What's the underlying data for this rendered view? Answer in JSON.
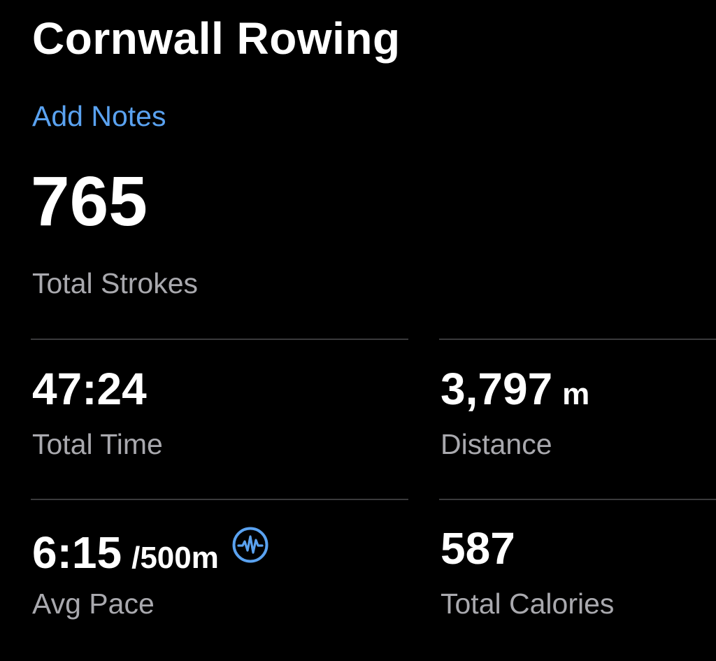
{
  "workout": {
    "title": "Cornwall Rowing",
    "add_notes_label": "Add Notes"
  },
  "colors": {
    "accent": "#5AA2F0",
    "label_gray": "#A9A9AE",
    "divider": "#3A3A3C",
    "background": "#000000",
    "text": "#FFFFFF"
  },
  "hero": {
    "value": "765",
    "label": "Total Strokes"
  },
  "metrics": {
    "total_time": {
      "value": "47:24",
      "label": "Total Time"
    },
    "distance": {
      "value": "3,797",
      "unit": "m",
      "label": "Distance"
    },
    "avg_pace": {
      "value": "6:15",
      "unit": "/500m",
      "label": "Avg Pace",
      "icon": "waveform-circle-icon"
    },
    "total_calories": {
      "value": "587",
      "label": "Total Calories"
    }
  }
}
